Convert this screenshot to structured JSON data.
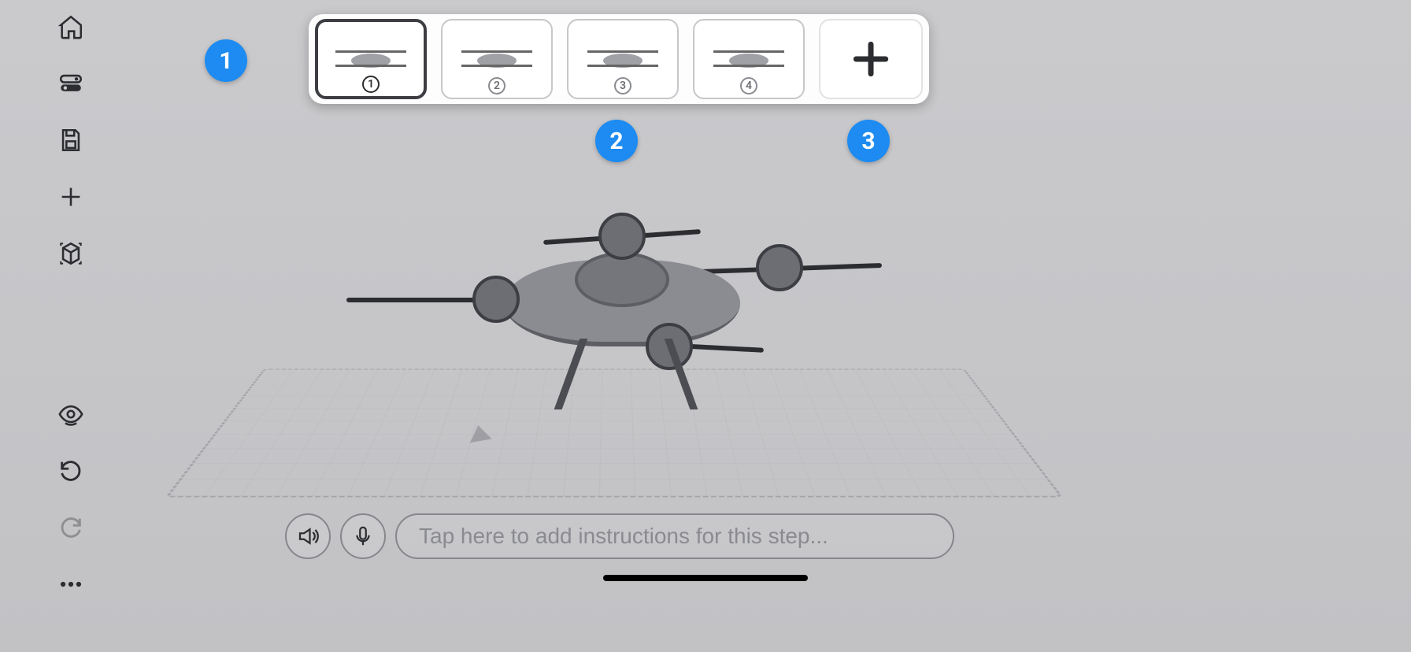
{
  "toolbar": {
    "home": "home-icon",
    "layers": "layers-toggle-icon",
    "save": "save-icon",
    "add": "plus-icon",
    "view3d": "ar-cube-icon",
    "visibility": "eye-icon",
    "undo": "undo-icon",
    "redo": "redo-icon",
    "more": "more-icon"
  },
  "steps": [
    {
      "index": "1",
      "selected": true
    },
    {
      "index": "2",
      "selected": false
    },
    {
      "index": "3",
      "selected": false
    },
    {
      "index": "4",
      "selected": false
    }
  ],
  "add_step_label": "+",
  "annotations": {
    "badge1": "1",
    "badge2": "2",
    "badge3": "3"
  },
  "bottom": {
    "audio_label": "audio",
    "mic_label": "microphone",
    "input_placeholder": "Tap here to add instructions for this step...",
    "input_value": ""
  },
  "colors": {
    "accent": "#1d8bf1",
    "ink": "#2c2d30",
    "bg": "#c9c9cc"
  }
}
